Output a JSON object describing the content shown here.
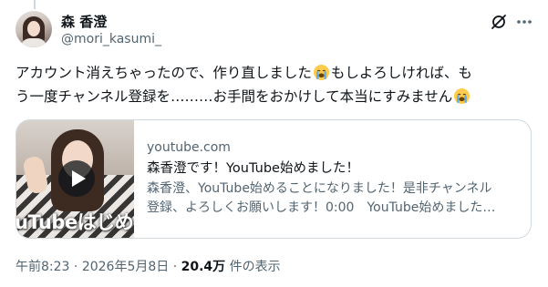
{
  "author": {
    "display_name": "森 香澄",
    "handle": "@mori_kasumi_"
  },
  "tweet": {
    "lines": [
      "アカウント消えちゃったので、作り直しました",
      "もしよろしければ、も",
      "う一度チャンネル登録を………お手間をおかけして本当にすみません"
    ],
    "emoji": "loudly-crying-face-emoji"
  },
  "card": {
    "thumbnail_caption": "uTubeはじめ",
    "domain": "youtube.com",
    "title": "森香澄です！YouTube始めました！",
    "description_lines": [
      "森香澄、YouTube始めることになりました！是非チャンネル",
      "登録、よろしくお願いします！0:00　YouTube始めました…"
    ]
  },
  "meta": {
    "time": "午前8:23",
    "separator": "·",
    "date": "2026年5月8日",
    "views": "20.4万",
    "views_suffix": "件の表示"
  },
  "icons": {
    "header_actions": [
      "grok-icon",
      "more-options-icon"
    ]
  },
  "colors": {
    "text_primary": "#0f1419",
    "text_secondary": "#536471",
    "border": "#cfd9de",
    "emoji_face": "#ffcc4d",
    "tear": "#5dadec"
  }
}
